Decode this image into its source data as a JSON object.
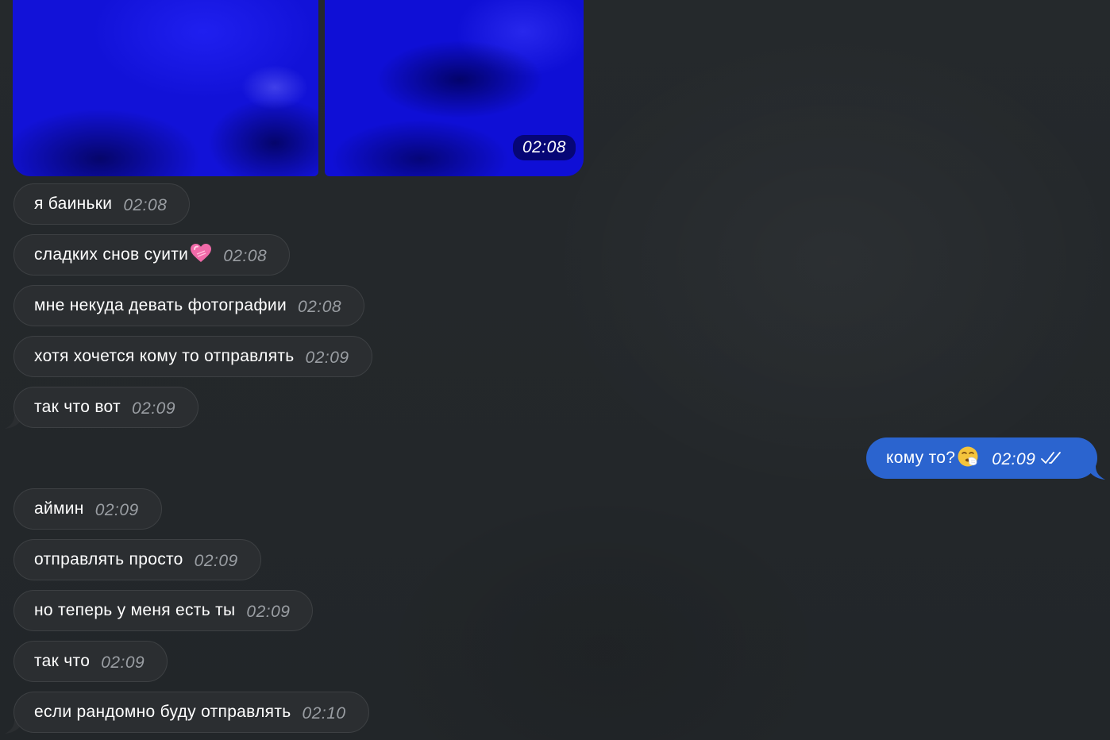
{
  "album": {
    "time": "02:08"
  },
  "incoming_top": [
    {
      "text": "я баиньки",
      "time": "02:08"
    },
    {
      "text": "сладких снов суити",
      "emoji": "pink-heart-icon",
      "time": "02:08"
    },
    {
      "text": "мне некуда девать фотографии",
      "time": "02:08"
    },
    {
      "text": "хотя хочется кому то отправлять",
      "time": "02:09"
    },
    {
      "text": "так что вот",
      "time": "02:09"
    }
  ],
  "outgoing": [
    {
      "text": "кому то?",
      "emoji": "sneezing-face-icon",
      "time": "02:09",
      "status": "read-double-check-icon"
    }
  ],
  "incoming_bottom": [
    {
      "text": "аймин",
      "time": "02:09"
    },
    {
      "text": "отправлять просто",
      "time": "02:09"
    },
    {
      "text": "но теперь у меня есть ты",
      "time": "02:09"
    },
    {
      "text": "так что",
      "time": "02:09"
    },
    {
      "text": "если рандомно буду отправлять",
      "time": "02:10"
    }
  ],
  "colors": {
    "background": "#23272a",
    "incoming_bubble": "#2b2e31",
    "outgoing_bubble": "#2b64cf",
    "photo_blue": "#1212d8"
  }
}
